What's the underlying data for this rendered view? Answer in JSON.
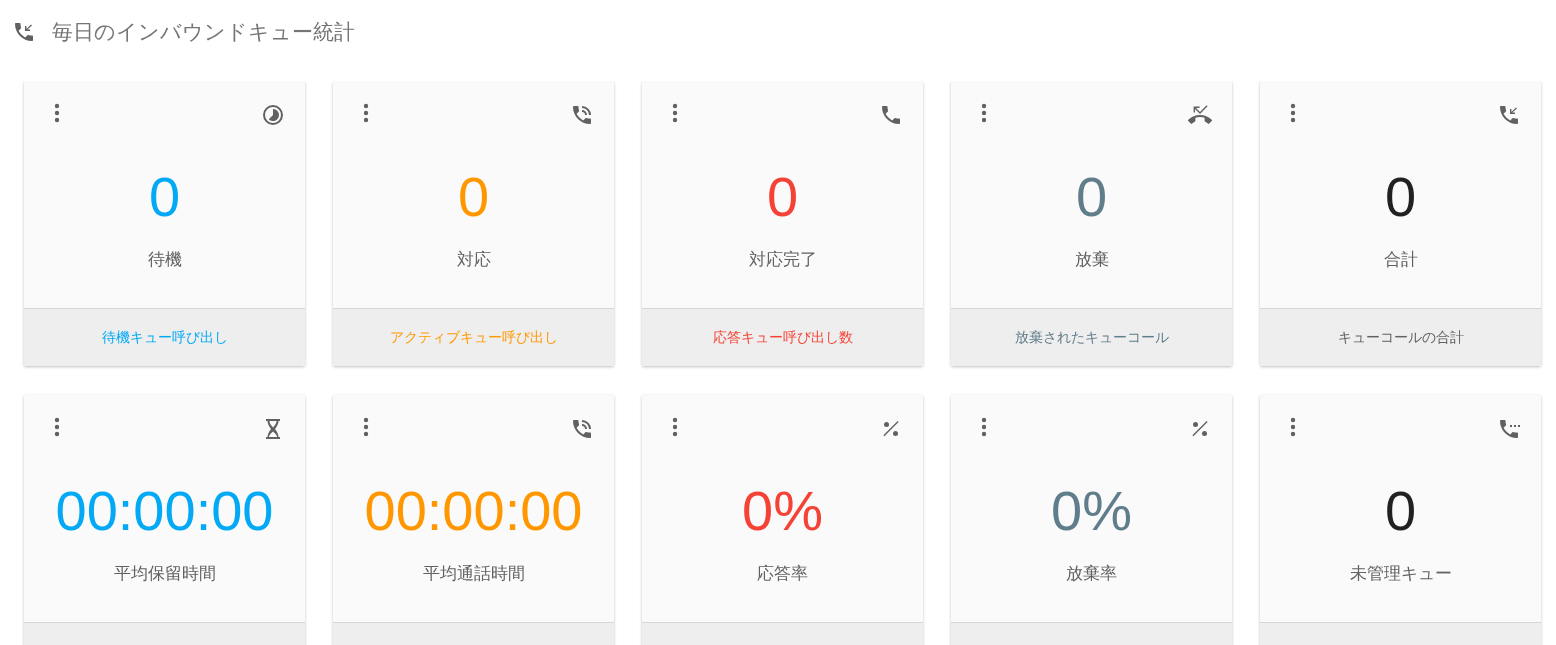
{
  "title": "毎日のインバウンドキュー統計",
  "cards": [
    {
      "value": "0",
      "label": "待機",
      "footer": "待機キュー呼び出し",
      "color": "#03a9f4"
    },
    {
      "value": "0",
      "label": "対応",
      "footer": "アクティブキュー呼び出し",
      "color": "#ff9800"
    },
    {
      "value": "0",
      "label": "対応完了",
      "footer": "応答キュー呼び出し数",
      "color": "#f44336"
    },
    {
      "value": "0",
      "label": "放棄",
      "footer": "放棄されたキューコール",
      "color": "#607d8b"
    },
    {
      "value": "0",
      "label": "合計",
      "footer": "キューコールの合計",
      "color": "#212121"
    },
    {
      "value": "00:00:00",
      "label": "平均保留時間",
      "color": "#03a9f4"
    },
    {
      "value": "00:00:00",
      "label": "平均通話時間",
      "color": "#ff9800"
    },
    {
      "value": "0%",
      "label": "応答率",
      "color": "#f44336"
    },
    {
      "value": "0%",
      "label": "放棄率",
      "color": "#607d8b"
    },
    {
      "value": "0",
      "label": "未管理キュー",
      "color": "#212121"
    }
  ]
}
